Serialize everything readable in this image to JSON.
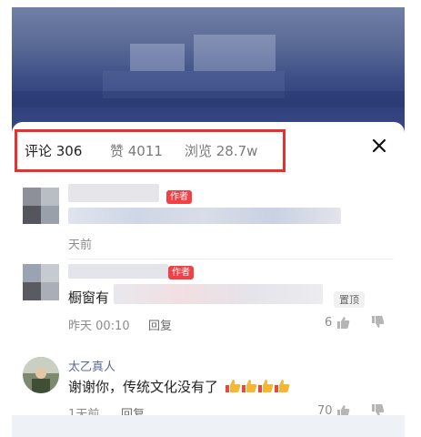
{
  "tabs": {
    "comments": "评论 306",
    "likes": "赞 4011",
    "views": "浏览 28.7w"
  },
  "comments": [
    {
      "tag": "作者",
      "time": "天前"
    },
    {
      "tag": "作者",
      "text": "橱窗有",
      "pinned": "置顶",
      "time": "昨天 00:10",
      "reply": "回复",
      "likes": "6"
    },
    {
      "name": "太乙真人",
      "text": "谢谢你，传统文化没有了",
      "time": "1天前",
      "reply": "回复",
      "likes": "70"
    }
  ],
  "icons": {
    "close": "close-icon",
    "like": "thumb-up-icon",
    "dislike": "thumb-down-icon",
    "emoji": "thumbs-up-emoji"
  },
  "colors": {
    "highlight": "#e5322d",
    "author_tag": "#f04146",
    "name": "#5b6b8c"
  }
}
